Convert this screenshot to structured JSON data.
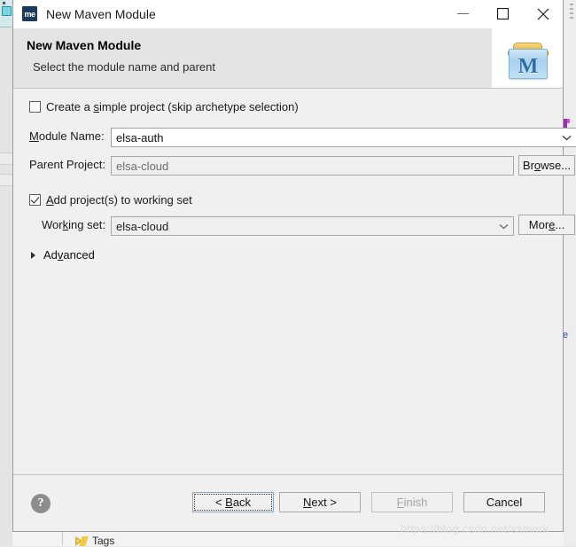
{
  "window": {
    "title": "New Maven Module",
    "icon_name": "maven-me-icon",
    "icon_text": "me",
    "controls": {
      "minimize": "minimize-icon",
      "maximize": "maximize-icon",
      "close": "close-icon"
    }
  },
  "header": {
    "title": "New Maven Module",
    "subtitle": "Select the module name and parent",
    "banner_icon": "maven-module-icon",
    "banner_letter": "M"
  },
  "form": {
    "simple_project": {
      "label_pre": "Create a ",
      "label_mnemonic": "s",
      "label_post": "imple project (skip archetype selection)",
      "checked": false
    },
    "module_name": {
      "label_mnemonic": "M",
      "label_pre": "",
      "label_post": "odule Name:",
      "value": "elsa-auth"
    },
    "parent_project": {
      "label": "Parent Project:",
      "value": "elsa-cloud",
      "browse_button": {
        "pre": "Br",
        "mnemonic": "o",
        "post": "wse..."
      }
    },
    "add_to_working_set": {
      "label_mnemonic": "A",
      "label_post": "dd project(s) to working set",
      "checked": true
    },
    "working_set": {
      "label_pre": "Wor",
      "label_mnemonic": "k",
      "label_post": "ing set:",
      "value": "elsa-cloud",
      "more_button": {
        "pre": "Mor",
        "mnemonic": "e",
        "post": "..."
      }
    },
    "advanced": {
      "label_pre": "Ad",
      "label_mnemonic": "v",
      "label_post": "anced",
      "expanded": false
    }
  },
  "footer": {
    "help_icon": "help-icon",
    "help_glyph": "?",
    "buttons": [
      {
        "name": "back",
        "pre": "< ",
        "mnemonic": "B",
        "post": "ack",
        "disabled": false,
        "focused": true
      },
      {
        "name": "next",
        "pre": "",
        "mnemonic": "N",
        "post": "ext >",
        "disabled": false,
        "focused": false
      },
      {
        "name": "finish",
        "pre": "",
        "mnemonic": "F",
        "post": "inish",
        "disabled": true,
        "focused": false
      },
      {
        "name": "cancel",
        "pre": "Cancel",
        "mnemonic": "",
        "post": "",
        "disabled": false,
        "focused": false
      }
    ]
  },
  "background": {
    "tags_label": "Tags",
    "watermark": "https://blog.csdn.net/ssmark"
  },
  "colors": {
    "dialog_bg": "#f0f0f0",
    "header_bg": "#e4e4e4",
    "titlebar_bg": "#ffffff",
    "accent_blue": "#2f6fa8",
    "maven_lid": "#eab93f",
    "tag_yellow": "#f0c94a",
    "focus_border": "#8aa9c9"
  }
}
